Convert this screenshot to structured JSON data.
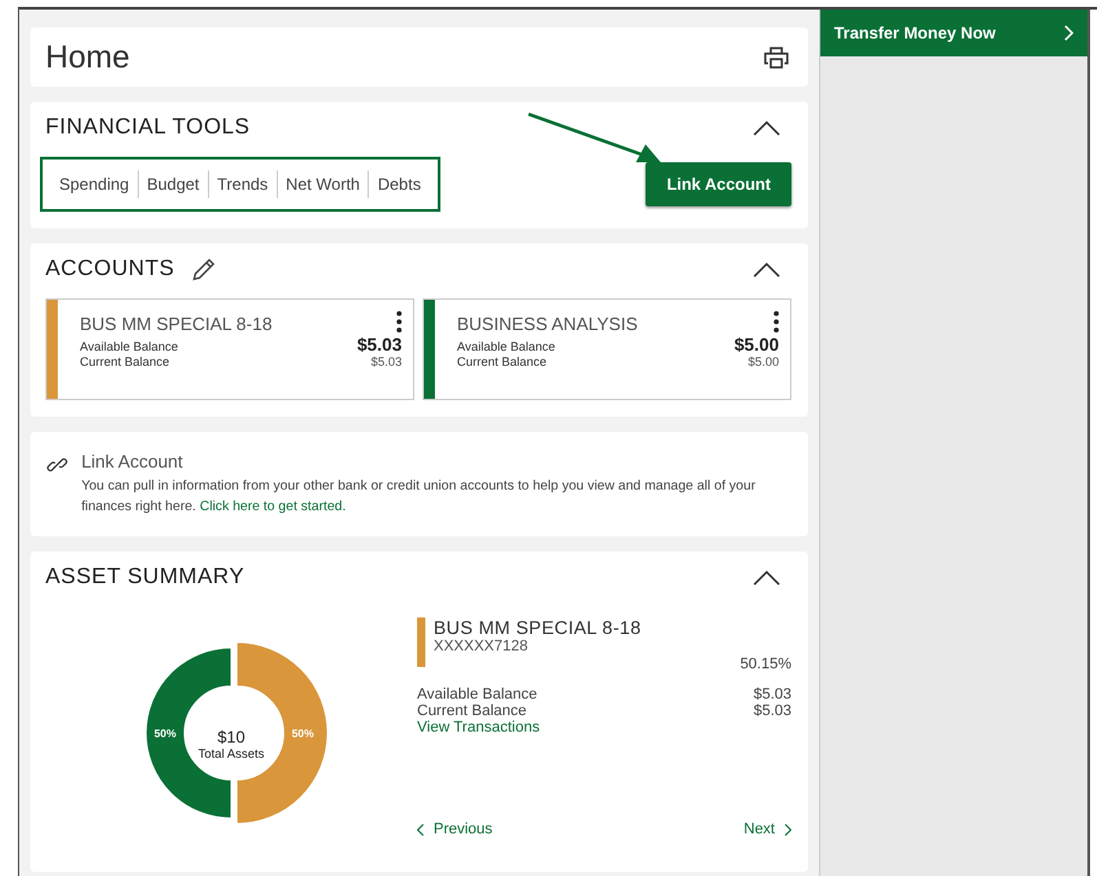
{
  "page_title": "Home",
  "financial_tools": {
    "title": "FINANCIAL TOOLS",
    "expanded": true,
    "tools": [
      "Spending",
      "Budget",
      "Trends",
      "Net Worth",
      "Debts"
    ],
    "link_button": "Link Account"
  },
  "accounts": {
    "title": "ACCOUNTS",
    "expanded": true,
    "items": [
      {
        "name": "BUS MM SPECIAL 8-18",
        "color": "#d9963a",
        "available_label": "Available Balance",
        "available": "$5.03",
        "current_label": "Current Balance",
        "current": "$5.03"
      },
      {
        "name": "BUSINESS ANALYSIS",
        "color": "#0a7035",
        "available_label": "Available Balance",
        "available": "$5.00",
        "current_label": "Current Balance",
        "current": "$5.00"
      }
    ]
  },
  "link_account": {
    "title": "Link Account",
    "text": "You can pull in information from your other bank or credit union accounts to help you view and manage all of your finances right here.",
    "link": "Click here to get started."
  },
  "asset_summary": {
    "title": "ASSET SUMMARY",
    "expanded": true,
    "chart_data": {
      "type": "donut",
      "values": [
        50,
        50
      ],
      "colors": [
        "#d9963a",
        "#0a7035"
      ],
      "value_labels": [
        "50%",
        "50%"
      ]
    },
    "total": "$10",
    "total_label": "Total Assets",
    "account": {
      "name": "BUS MM SPECIAL 8-18",
      "color": "#d9963a",
      "number": "XXXXXX7128",
      "share": "50.15%",
      "available_label": "Available Balance",
      "available": "$5.03",
      "current_label": "Current Balance",
      "current": "$5.03",
      "link": "View Transactions"
    },
    "previous": "Previous",
    "next": "Next"
  },
  "sidebar": {
    "transfer_button": "Transfer Money Now"
  }
}
